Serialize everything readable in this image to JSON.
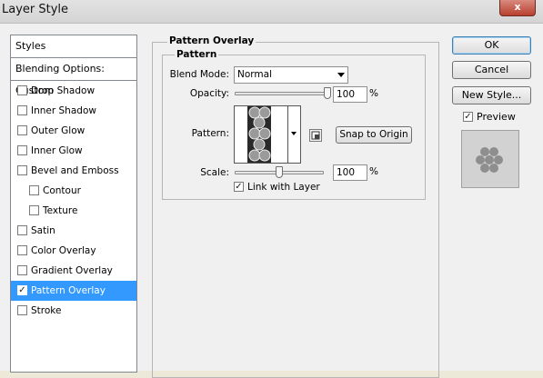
{
  "window": {
    "title": "Layer Style",
    "close_label": "x"
  },
  "styles_panel": {
    "header": "Styles",
    "blending": "Blending Options: Custom",
    "items": [
      {
        "label": "Drop Shadow",
        "checked": false
      },
      {
        "label": "Inner Shadow",
        "checked": false
      },
      {
        "label": "Outer Glow",
        "checked": false
      },
      {
        "label": "Inner Glow",
        "checked": false
      },
      {
        "label": "Bevel and Emboss",
        "checked": false
      },
      {
        "label": "Contour",
        "checked": false,
        "indent": true
      },
      {
        "label": "Texture",
        "checked": false,
        "indent": true
      },
      {
        "label": "Satin",
        "checked": false
      },
      {
        "label": "Color Overlay",
        "checked": false
      },
      {
        "label": "Gradient Overlay",
        "checked": false
      },
      {
        "label": "Pattern Overlay",
        "checked": true,
        "selected": true
      },
      {
        "label": "Stroke",
        "checked": false
      }
    ],
    "check_mark": "✓"
  },
  "pattern_overlay": {
    "group_title": "Pattern Overlay",
    "subgroup_title": "Pattern",
    "blend_mode_label": "Blend Mode:",
    "blend_mode_value": "Normal",
    "opacity_label": "Opacity:",
    "opacity_value": "100",
    "opacity_unit": "%",
    "opacity_level": 1.0,
    "pattern_label": "Pattern:",
    "snap_button": "Snap to Origin",
    "scale_label": "Scale:",
    "scale_value": "100",
    "scale_unit": "%",
    "scale_level": 0.5,
    "link_label": "Link with Layer",
    "link_checked": true
  },
  "buttons": {
    "ok": "OK",
    "cancel": "Cancel",
    "new_style": "New Style...",
    "preview_label": "Preview",
    "preview_checked": true
  }
}
